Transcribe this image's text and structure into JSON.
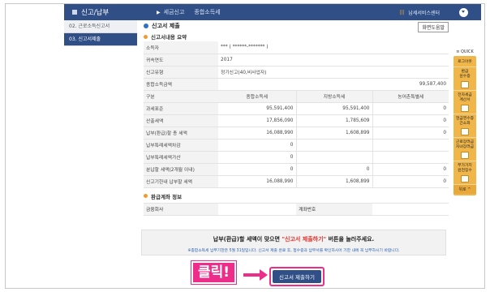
{
  "topbar": {
    "menu_title": "신고/납부",
    "crumbs": [
      "세금신고",
      "종합소득세"
    ],
    "doc_label": "납세서비스센터"
  },
  "leftnav": {
    "items": [
      {
        "label": "02. 근로소득신고서"
      },
      {
        "label": "03. 신고서제출"
      }
    ]
  },
  "main": {
    "title": "신고서 제출",
    "help_button": "화면도움말",
    "summary_title": "신고서내용 요약",
    "rows": {
      "taxpayer": {
        "label": "소득자",
        "value": "*** ( ******-******* )"
      },
      "year": {
        "label": "귀속연도",
        "value": "2017"
      },
      "type": {
        "label": "신고유형",
        "value": "정기신고(40,비사업자)"
      },
      "total_income": {
        "label": "종합소득금액",
        "value": "99,587,400"
      }
    },
    "columns": {
      "item": "구분",
      "income_tax": "종합소득세",
      "local_tax": "지방소득세",
      "rural_tax": "농어촌특별세"
    },
    "table_rows": [
      {
        "label": "과세표준",
        "income_tax": "95,591,400",
        "local_tax": "95,591,400",
        "rural_tax": "0"
      },
      {
        "label": "산출세액",
        "income_tax": "17,856,090",
        "local_tax": "1,785,609",
        "rural_tax": "0"
      },
      {
        "label": "납부(환급)할 총 세액",
        "income_tax": "16,088,990",
        "local_tax": "1,608,899",
        "rural_tax": "0"
      },
      {
        "label": "납부특례세액차감",
        "income_tax": "0",
        "local_tax": "",
        "rural_tax": ""
      },
      {
        "label": "납부특례세액가산",
        "income_tax": "0",
        "local_tax": "",
        "rural_tax": ""
      },
      {
        "label": "분납할 세액(2개월 이내)",
        "income_tax": "0",
        "local_tax": "0",
        "rural_tax": "0"
      },
      {
        "label": "신고기한내 납부할 세액",
        "income_tax": "16,088,990",
        "local_tax": "1,608,899",
        "rural_tax": "0"
      }
    ],
    "refund_title": "환급계좌 정보",
    "bank_label": "금융회사",
    "account_label": "계좌번호"
  },
  "notice": {
    "line1_pre": "납부(환급)할 세액이 맞으면 ",
    "line1_red": "\"신고서 제출하기\"",
    "line1_post": " 버튼을 눌러주세요.",
    "line2": "※종합소득세 납부기한은 5월 31일입니다. 신고서 제출 완료 후, 접수증과 납부서를 확인하시어 기한 내에 꼭 납부하시기 바랍니다."
  },
  "click_label": "클릭!",
  "submit_button": "신고서 제출하기",
  "quick": {
    "title": "≡ QUICK",
    "items": [
      "로그아웃",
      "환급\n원수증",
      "전자세금\n계산서",
      "현금영수증\n간소화",
      "근로장려금\n자녀장려금",
      "부가가치\n원천징수"
    ],
    "up": "위로 ^"
  },
  "colors": {
    "navy": "#2f4f86",
    "accent": "#ee2d8a",
    "notice_red": "#e0322b",
    "quick_bg": "#f0b64a"
  }
}
